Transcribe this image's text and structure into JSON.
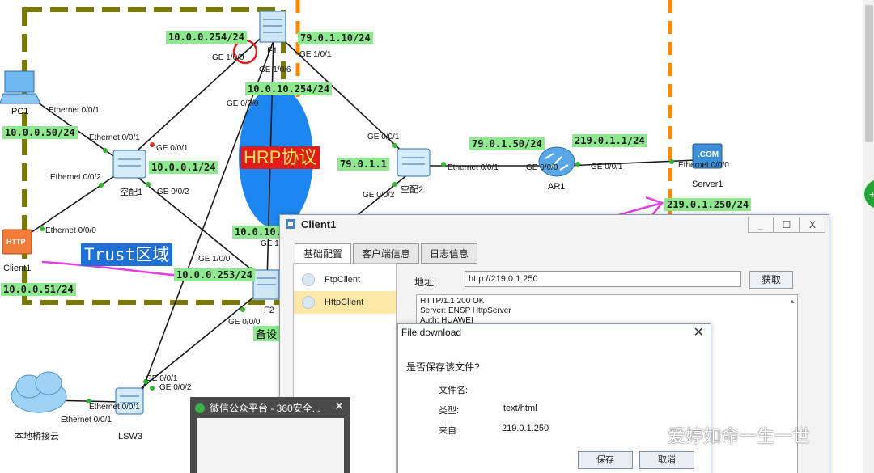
{
  "topology": {
    "address_labels": {
      "fw1_g100": "10.0.0.254/24",
      "fw1_g101": "79.0.1.10/24",
      "fw1_g106": "10.0.10.254/24",
      "pc1": "10.0.0.50/24",
      "sw1": "10.0.0.1/24",
      "sw2": "79.0.1.1",
      "ar1_g000": "79.0.1.50/24",
      "ar1_g001": "219.0.1.1/24",
      "server1": "219.0.1.250/24",
      "fw2_partial": "10.0.10.",
      "fw2_g100": "10.0.0.253/24",
      "client1": "10.0.0.51/24"
    },
    "port_labels": {
      "fw1_ge100": "GE 1/0/0",
      "fw1_ge101": "GE 1/0/1",
      "fw1_ge106": "GE 1/0/6",
      "fw1_ge000": "GE 0/0/0",
      "pc1_eth": "Ethernet 0/0/1",
      "sw1_eth001": "Ethernet 0/0/1",
      "sw1_ge001": "GE 0/0/1",
      "sw1_eth002": "Ethernet 0/0/2",
      "sw1_ge002": "GE 0/0/2",
      "client_eth": "Ethernet 0/0/0",
      "sw2_ge001": "GE 0/0/1",
      "sw2_ge002": "GE 0/0/2",
      "sw2_eth": "Ethernet 0/0/1",
      "ar1_ge000": "GE 0/0/0",
      "ar1_ge001": "GE 0/0/1",
      "server_eth": "Ethernet 0/0/0",
      "fw2_ge100": "GE 1/0/0",
      "fw2_ge1": "GE 1.",
      "fw2_ge000": "GE 0/0/0",
      "lsw3_ge001": "GE 0/0/1",
      "lsw3_ge002": "GE 0/0/2",
      "lsw3_eth001": "Ethernet 0/0/1",
      "cloud_eth": "Ethernet 0/0/1"
    },
    "device_names": {
      "pc1": "PC1",
      "fw1": "F1",
      "sw1": "空配1",
      "sw2": "空配2",
      "ar1": "AR1",
      "server1": "Server1",
      "client1": "Client1",
      "fw2": "F2",
      "lsw3": "LSW3",
      "cloud": "本地桥接云"
    },
    "hrp_label": "HRP协议",
    "trust_label": "Trust区域",
    "backup_label": "备设",
    "http_icon_text": "HTTP",
    "com_icon_text": ".COM"
  },
  "client_window": {
    "title": "Client1",
    "buttons": {
      "minimize": "_",
      "maximize": "☐",
      "close": "X"
    },
    "tabs": [
      "基础配置",
      "客户端信息",
      "日志信息"
    ],
    "active_tab": 0,
    "left_items": [
      "FtpClient",
      "HttpClient"
    ],
    "selected_item": 1,
    "address_label": "地址:",
    "address_value": "http://219.0.1.250",
    "fetch_button": "获取",
    "response_lines": [
      "HTTP/1.1 200 OK",
      "Server: ENSP HttpServer",
      "Auth: HUAWEI"
    ]
  },
  "download_dialog": {
    "title": "File download",
    "close": "✕",
    "question": "是否保存该文件?",
    "filename_label": "文件名:",
    "filename_value": "",
    "type_label": "类型:",
    "type_value": "text/html",
    "from_label": "来自:",
    "from_value": "219.0.1.250",
    "save_button": "保存",
    "cancel_button": "取消"
  },
  "taskbar_preview": {
    "title": "微信公众平台 - 360安全...",
    "close": "✕"
  },
  "watermark": "爱婷如命一生一世",
  "colors": {
    "trust_zone": "#7a7a00",
    "zone_orange": "#ff8a00",
    "arrow_magenta": "#e23ee2",
    "label_green": "#8fe88f",
    "hrp_red": "#e21b1b",
    "hrp_blue": "#1e86f0"
  }
}
